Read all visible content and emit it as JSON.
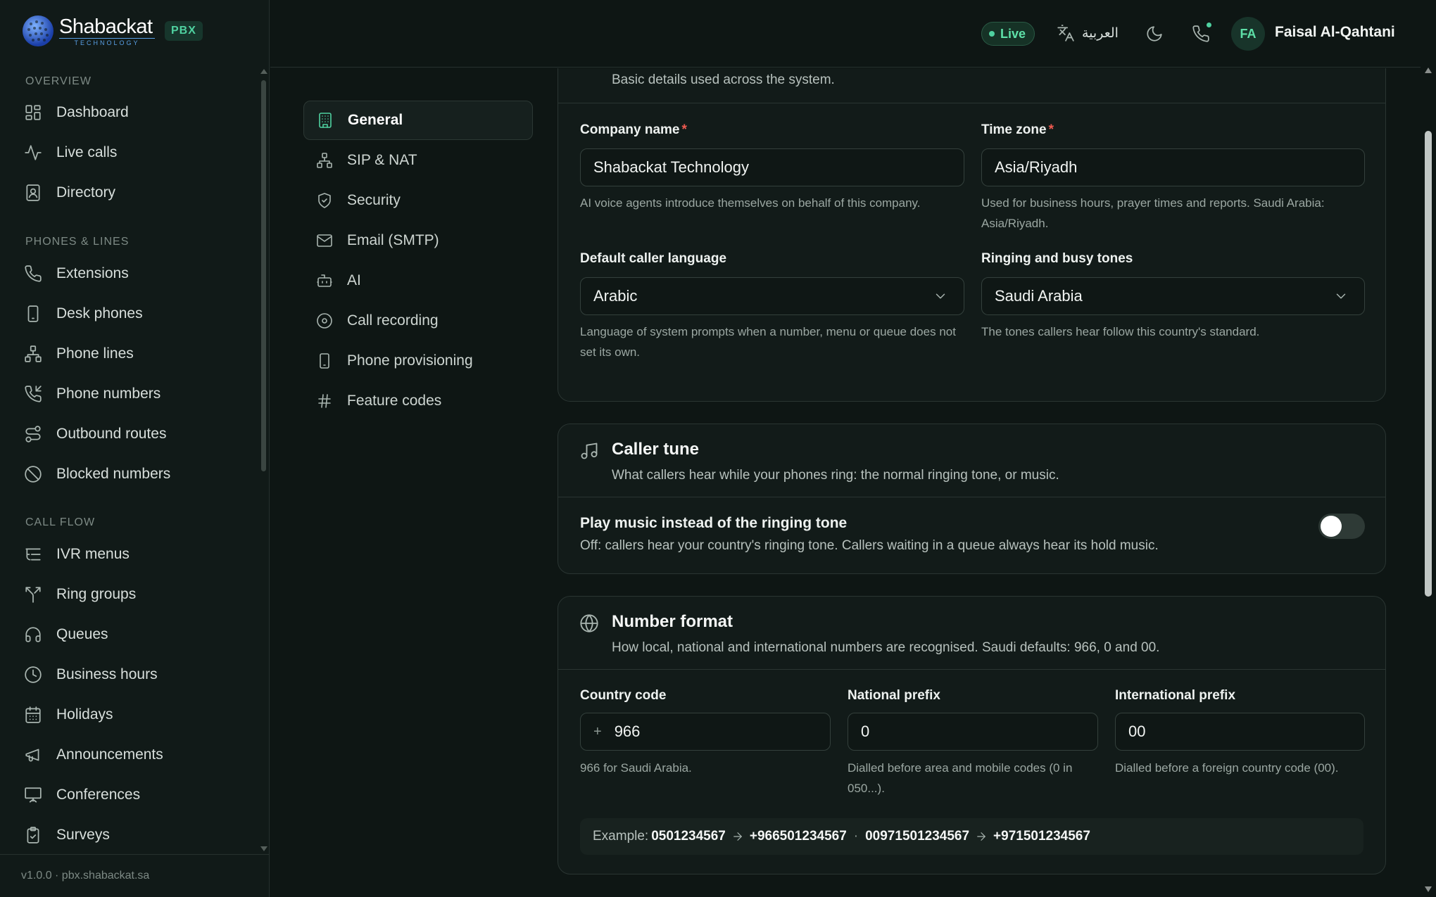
{
  "brand": {
    "name": "Shabackat",
    "sub": "TECHNOLOGY",
    "badge": "PBX"
  },
  "colors": {
    "accent": "#4fd1a0",
    "required": "#ef5a50",
    "background": "#0e1614"
  },
  "sidebar": {
    "sections": [
      {
        "title": "OVERVIEW",
        "items": [
          {
            "label": "Dashboard",
            "icon": "dashboard-icon"
          },
          {
            "label": "Live calls",
            "icon": "activity-icon"
          },
          {
            "label": "Directory",
            "icon": "contact-book-icon"
          }
        ]
      },
      {
        "title": "PHONES & LINES",
        "items": [
          {
            "label": "Extensions",
            "icon": "phone-icon"
          },
          {
            "label": "Desk phones",
            "icon": "desk-phone-icon"
          },
          {
            "label": "Phone lines",
            "icon": "network-icon"
          },
          {
            "label": "Phone numbers",
            "icon": "phone-incoming-icon"
          },
          {
            "label": "Outbound routes",
            "icon": "route-icon"
          },
          {
            "label": "Blocked numbers",
            "icon": "ban-icon"
          }
        ]
      },
      {
        "title": "CALL FLOW",
        "items": [
          {
            "label": "IVR menus",
            "icon": "list-tree-icon"
          },
          {
            "label": "Ring groups",
            "icon": "split-icon"
          },
          {
            "label": "Queues",
            "icon": "headphones-icon"
          },
          {
            "label": "Business hours",
            "icon": "clock-icon"
          },
          {
            "label": "Holidays",
            "icon": "calendar-icon"
          },
          {
            "label": "Announcements",
            "icon": "megaphone-icon"
          },
          {
            "label": "Conferences",
            "icon": "presentation-icon"
          },
          {
            "label": "Surveys",
            "icon": "clipboard-check-icon"
          }
        ]
      }
    ],
    "footer": "v1.0.0 · pbx.shabackat.sa"
  },
  "header": {
    "status": "Live",
    "language": "العربية",
    "user_initials": "FA",
    "user_name": "Faisal Al-Qahtani"
  },
  "settings_nav": [
    {
      "label": "General",
      "icon": "building-icon",
      "active": true
    },
    {
      "label": "SIP & NAT",
      "icon": "network-icon"
    },
    {
      "label": "Security",
      "icon": "shield-icon"
    },
    {
      "label": "Email (SMTP)",
      "icon": "mail-icon"
    },
    {
      "label": "AI",
      "icon": "bot-icon"
    },
    {
      "label": "Call recording",
      "icon": "record-icon"
    },
    {
      "label": "Phone provisioning",
      "icon": "smartphone-icon"
    },
    {
      "label": "Feature codes",
      "icon": "hash-icon"
    }
  ],
  "general": {
    "description": "Basic details used across the system.",
    "company_name": {
      "label": "Company name",
      "value": "Shabackat Technology",
      "help": "AI voice agents introduce themselves on behalf of this company."
    },
    "time_zone": {
      "label": "Time zone",
      "value": "Asia/Riyadh",
      "help": "Used for business hours, prayer times and reports. Saudi Arabia: Asia/Riyadh."
    },
    "caller_language": {
      "label": "Default caller language",
      "value": "Arabic",
      "help": "Language of system prompts when a number, menu or queue does not set its own."
    },
    "tones": {
      "label": "Ringing and busy tones",
      "value": "Saudi Arabia",
      "help": "The tones callers hear follow this country's standard."
    },
    "required_mark": "*"
  },
  "caller_tune": {
    "title": "Caller tune",
    "description": "What callers hear while your phones ring: the normal ringing tone, or music.",
    "toggle_label": "Play music instead of the ringing tone",
    "toggle_help": "Off: callers hear your country's ringing tone. Callers waiting in a queue always hear its hold music.",
    "toggle_on": false
  },
  "number_format": {
    "title": "Number format",
    "description": "How local, national and international numbers are recognised. Saudi defaults: 966, 0 and 00.",
    "country_code": {
      "label": "Country code",
      "prefix": "+",
      "value": "966",
      "help": "966 for Saudi Arabia."
    },
    "national_prefix": {
      "label": "National prefix",
      "value": "0",
      "help": "Dialled before area and mobile codes (0 in 050...)."
    },
    "international_prefix": {
      "label": "International prefix",
      "value": "00",
      "help": "Dialled before a foreign country code (00)."
    },
    "example": {
      "label": "Example:",
      "local": "0501234567",
      "local_result": "+966501234567",
      "sep": "·",
      "intl": "00971501234567",
      "intl_result": "+971501234567"
    }
  }
}
